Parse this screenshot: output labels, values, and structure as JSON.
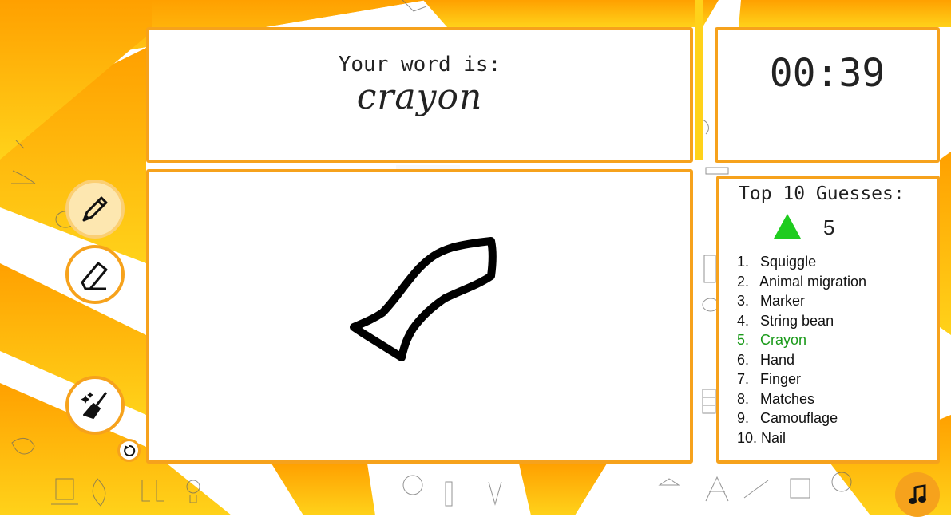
{
  "word_panel": {
    "label": "Your word is:",
    "word": "crayon"
  },
  "timer": {
    "time": "00:39"
  },
  "guesses": {
    "title": "Top 10 Guesses:",
    "rank": "5",
    "rank_trend": "up",
    "items": [
      {
        "num": "1.",
        "text": "Squiggle"
      },
      {
        "num": "2.",
        "text": "Animal migration"
      },
      {
        "num": "3.",
        "text": "Marker"
      },
      {
        "num": "4.",
        "text": "String bean"
      },
      {
        "num": "5.",
        "text": "Crayon"
      },
      {
        "num": "6.",
        "text": "Hand"
      },
      {
        "num": "7.",
        "text": "Finger"
      },
      {
        "num": "8.",
        "text": "Matches"
      },
      {
        "num": "9.",
        "text": "Camouflage"
      },
      {
        "num": "10.",
        "text": "Nail"
      }
    ],
    "highlight_index": 4
  },
  "tools": {
    "pencil_icon": "pencil-icon",
    "eraser_icon": "eraser-icon",
    "clear_icon": "broom-icon",
    "undo_icon": "undo-icon",
    "music_icon": "music-note-icon"
  },
  "colors": {
    "accent": "#f6a21c",
    "highlight": "#1a9a1a",
    "rank_up": "#1fcc1f",
    "bg_yellow": "#fdd017",
    "bg_orange": "#ffa500"
  }
}
